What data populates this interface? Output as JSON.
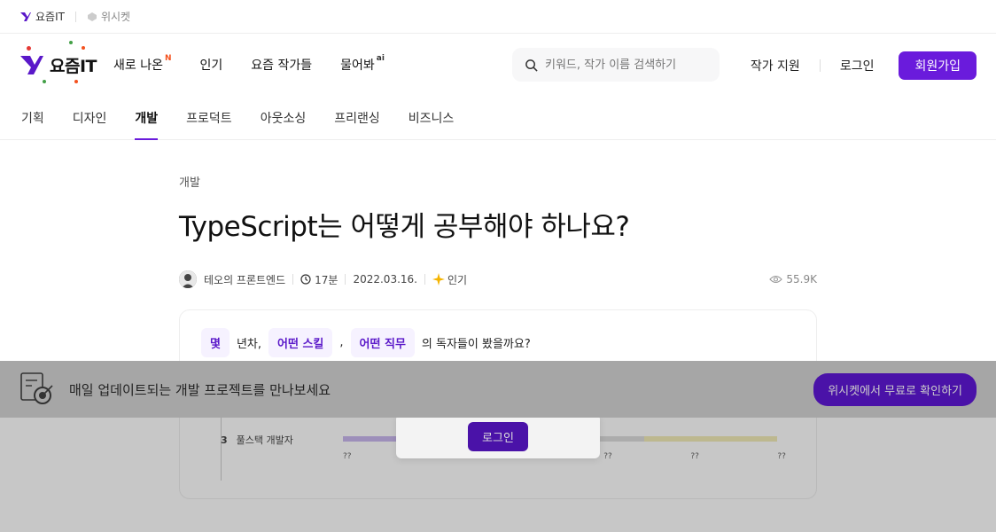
{
  "utility": {
    "brand": "요즘IT",
    "wishket": "위시켓"
  },
  "header": {
    "logo_text": "요즘IT",
    "nav": [
      {
        "label": "새로 나온",
        "sup": "N"
      },
      {
        "label": "인기",
        "sup": ""
      },
      {
        "label": "요즘 작가들",
        "sup": ""
      },
      {
        "label": "물어봐",
        "sup": "ai"
      }
    ],
    "search_placeholder": "키워드, 작가 이름 검색하기",
    "writer_support": "작가 지원",
    "login": "로그인",
    "signup": "회원가입"
  },
  "categories": [
    {
      "label": "기획",
      "active": false
    },
    {
      "label": "디자인",
      "active": false
    },
    {
      "label": "개발",
      "active": true
    },
    {
      "label": "프로덕트",
      "active": false
    },
    {
      "label": "아웃소싱",
      "active": false
    },
    {
      "label": "프리랜싱",
      "active": false
    },
    {
      "label": "비즈니스",
      "active": false
    }
  ],
  "article": {
    "category": "개발",
    "title": "TypeScript는 어떻게 공부해야 하나요?",
    "author": "테오의 프론트엔드",
    "read_time": "17분",
    "date": "2022.03.16.",
    "badge": "인기",
    "views": "55.9K"
  },
  "survey": {
    "chip1": "몇",
    "text1": "년차,",
    "chip2": "어떤 스킬",
    "text2": ",",
    "chip3": "어떤 직무",
    "text3": "의 독자들이 봤을까요?",
    "row_rank": "3",
    "row_label": "풀스택 개발자",
    "ticks": [
      "??",
      "??",
      "??",
      "??",
      "??",
      "??"
    ]
  },
  "overlay": {
    "login_button": "로그인",
    "banner_text": "매일 업데이트되는 개발 프로젝트를 만나보세요",
    "banner_button": "위시켓에서 무료로 확인하기"
  },
  "colors": {
    "accent": "#6a1bdc",
    "chip_bg": "#f6f2ff"
  }
}
